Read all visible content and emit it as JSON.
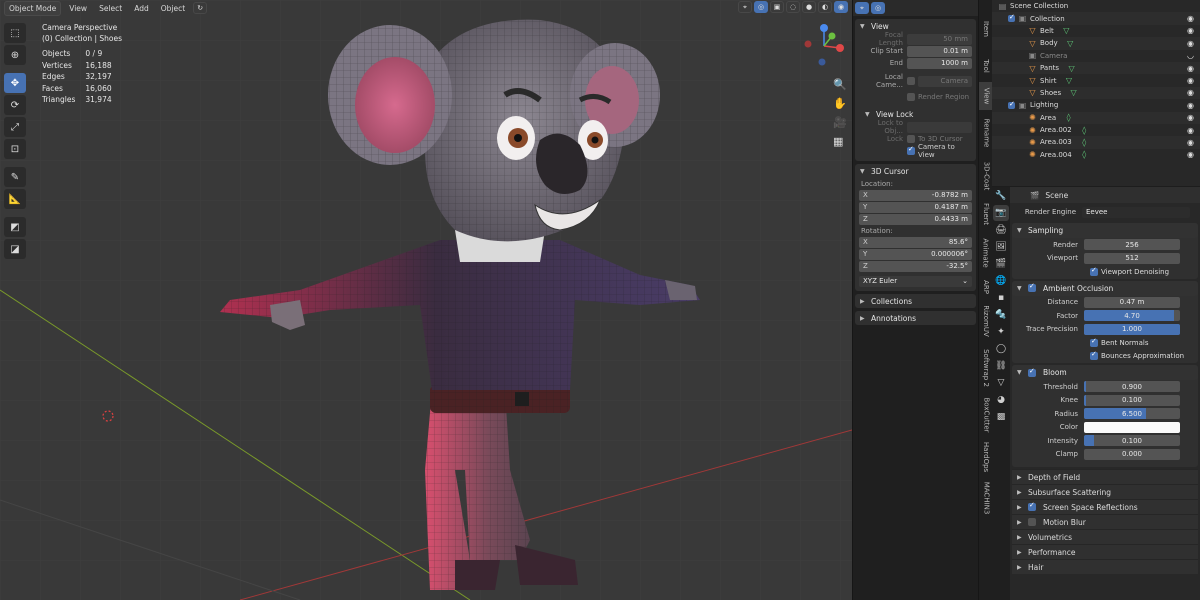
{
  "viewport": {
    "header": {
      "mode": "Object Mode",
      "menus": [
        "View",
        "Select",
        "Add",
        "Object"
      ]
    },
    "stats": {
      "title": "Camera Perspective",
      "subtitle": "(0) Collection | Shoes",
      "rows": [
        {
          "label": "Objects",
          "value": "0 / 9"
        },
        {
          "label": "Vertices",
          "value": "16,188"
        },
        {
          "label": "Edges",
          "value": "32,197"
        },
        {
          "label": "Faces",
          "value": "16,060"
        },
        {
          "label": "Triangles",
          "value": "31,974"
        }
      ]
    },
    "tools": [
      "select-box-icon",
      "cursor-icon",
      "move-icon",
      "rotate-icon",
      "scale-icon",
      "transform-icon",
      "annotate-icon",
      "measure-icon",
      "add-cube-icon",
      "extrude-icon"
    ]
  },
  "npanel": {
    "view": {
      "title": "View",
      "focal_length_label": "Focal Length",
      "focal_length": "50 mm",
      "clip_start_label": "Clip Start",
      "clip_start": "0.01 m",
      "clip_end_label": "End",
      "clip_end": "1000 m",
      "local_camera_label": "Local Came...",
      "local_camera_value": "Camera",
      "render_region": "Render Region"
    },
    "view_lock": {
      "title": "View Lock",
      "lock_to_object_label": "Lock to Obj...",
      "lock_label": "Lock",
      "to_3d_cursor": "To 3D Cursor",
      "camera_to_view": "Camera to View"
    },
    "cursor": {
      "title": "3D Cursor",
      "location_label": "Location:",
      "location": [
        {
          "axis": "X",
          "value": "-0.8782 m"
        },
        {
          "axis": "Y",
          "value": "0.4187 m"
        },
        {
          "axis": "Z",
          "value": "0.4433 m"
        }
      ],
      "rotation_label": "Rotation:",
      "rotation": [
        {
          "axis": "X",
          "value": "85.6°"
        },
        {
          "axis": "Y",
          "value": "0.000006°"
        },
        {
          "axis": "Z",
          "value": "-32.5°"
        }
      ],
      "rotation_mode": "XYZ Euler"
    },
    "collections": "Collections",
    "annotations": "Annotations"
  },
  "vtabs": [
    "Item",
    "Tool",
    "View",
    "Rename",
    "3D-Coat",
    "Fluent",
    "Animate",
    "ARP",
    "RizomUV",
    "Softwrap 2",
    "BoxCutter",
    "HardOps",
    "MACHIN3"
  ],
  "outliner": {
    "rows": [
      {
        "label": "Scene Collection",
        "indent": 0,
        "icon": "scene-collection-icon"
      },
      {
        "label": "Collection",
        "indent": 1,
        "icon": "collection-icon"
      },
      {
        "label": "Belt",
        "indent": 2,
        "icon": "mesh-icon"
      },
      {
        "label": "Body",
        "indent": 2,
        "icon": "mesh-icon"
      },
      {
        "label": "Camera",
        "indent": 2,
        "icon": "camera-icon"
      },
      {
        "label": "Pants",
        "indent": 2,
        "icon": "mesh-icon"
      },
      {
        "label": "Shirt",
        "indent": 2,
        "icon": "mesh-icon"
      },
      {
        "label": "Shoes",
        "indent": 2,
        "icon": "mesh-icon"
      },
      {
        "label": "Lighting",
        "indent": 1,
        "icon": "collection-icon"
      },
      {
        "label": "Area",
        "indent": 2,
        "icon": "light-icon"
      },
      {
        "label": "Area.002",
        "indent": 2,
        "icon": "light-icon"
      },
      {
        "label": "Area.003",
        "indent": 2,
        "icon": "light-icon"
      },
      {
        "label": "Area.004",
        "indent": 2,
        "icon": "light-icon"
      }
    ]
  },
  "props": {
    "scene": "Scene",
    "render_engine_label": "Render Engine",
    "render_engine": "Eevee",
    "sampling": {
      "title": "Sampling",
      "render_label": "Render",
      "render": "256",
      "viewport_label": "Viewport",
      "viewport": "512",
      "denoise": "Viewport Denoising"
    },
    "ao": {
      "title": "Ambient Occlusion",
      "distance_label": "Distance",
      "distance": "0.47 m",
      "factor_label": "Factor",
      "factor": "4.70",
      "factor_fill": 0.94,
      "trace_label": "Trace Precision",
      "trace": "1.000",
      "trace_fill": 1.0,
      "bent_normals": "Bent Normals",
      "bounces": "Bounces Approximation"
    },
    "bloom": {
      "title": "Bloom",
      "threshold_label": "Threshold",
      "threshold": "0.900",
      "threshold_fill": 0.02,
      "knee_label": "Knee",
      "knee": "0.100",
      "knee_fill": 0.02,
      "radius_label": "Radius",
      "radius": "6.500",
      "radius_fill": 0.65,
      "color_label": "Color",
      "intensity_label": "Intensity",
      "intensity": "0.100",
      "intensity_fill": 0.1,
      "clamp_label": "Clamp",
      "clamp": "0.000"
    },
    "closed_sections": [
      {
        "label": "Depth of Field",
        "check": null
      },
      {
        "label": "Subsurface Scattering",
        "check": null
      },
      {
        "label": "Screen Space Reflections",
        "check": true
      },
      {
        "label": "Motion Blur",
        "check": false
      },
      {
        "label": "Volumetrics",
        "check": null
      },
      {
        "label": "Performance",
        "check": null
      },
      {
        "label": "Hair",
        "check": null
      }
    ]
  },
  "colors": {
    "accent": "#4772b3",
    "viewport_bg": "#3a3a3a",
    "panel_bg": "#303030"
  }
}
